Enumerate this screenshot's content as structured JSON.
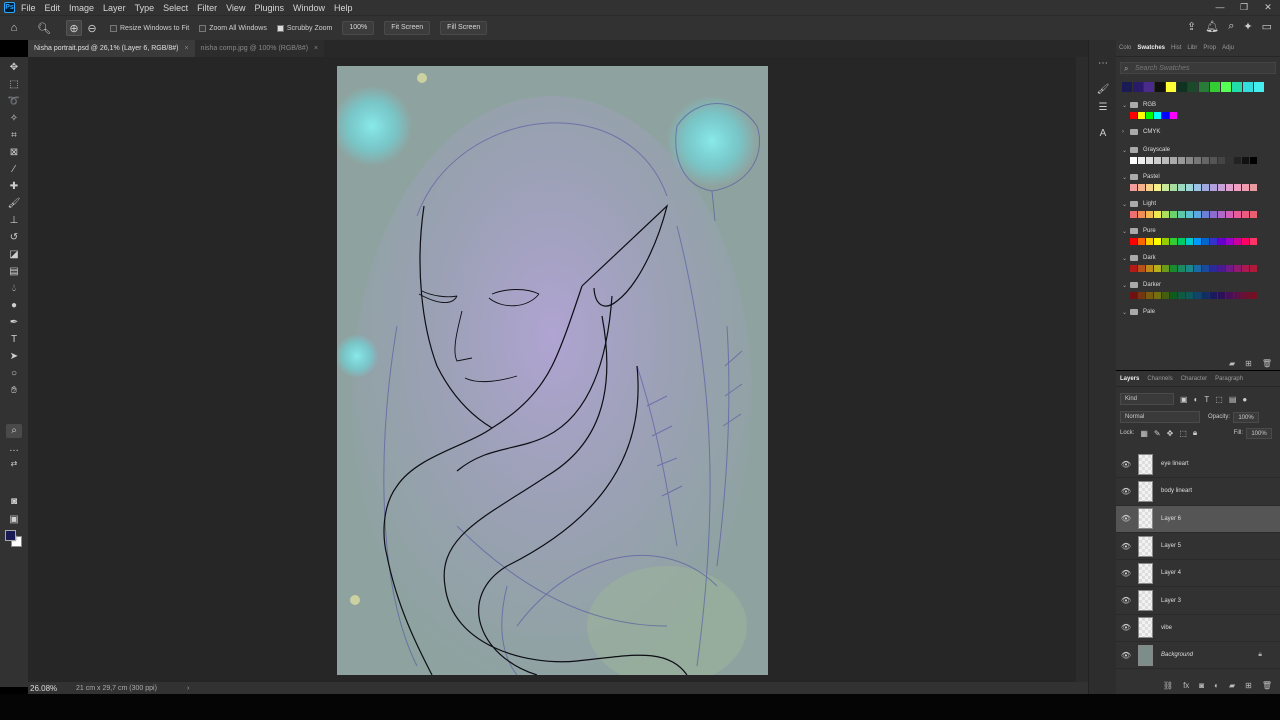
{
  "app": {
    "logo_text": "Ps"
  },
  "menu": [
    "File",
    "Edit",
    "Image",
    "Layer",
    "Type",
    "Select",
    "Filter",
    "View",
    "Plugins",
    "Window",
    "Help"
  ],
  "window_controls": {
    "minimize": "—",
    "restore": "❐",
    "close": "✕"
  },
  "options": {
    "resize_windows": "Resize Windows to Fit",
    "zoom_all": "Zoom All Windows",
    "scrubby_zoom": "Scrubby Zoom",
    "scrubby_checked": true,
    "btn_100": "100%",
    "btn_fit": "Fit Screen",
    "btn_fill": "Fill Screen"
  },
  "tabs": [
    {
      "label": "Nisha portrait.psd @ 26,1% (Layer 6, RGB/8#)",
      "active": true
    },
    {
      "label": "nisha comp.jpg @ 100% (RGB/8#)",
      "active": false
    }
  ],
  "status": {
    "zoom": "26.08%",
    "dims": "21 cm x 29,7 cm (300 ppi)",
    "arrow": "›"
  },
  "swatches": {
    "tabs": [
      "Colo",
      "Swatches",
      "Hist",
      "Libr",
      "Prop",
      "Adju"
    ],
    "search_placeholder": "Search Swatches",
    "recent": [
      "#1a1a55",
      "#2a1a6a",
      "#4a2a8a",
      "#111111",
      "#ffff33",
      "#0f3320",
      "#1a4a2a",
      "#2a7a3a",
      "#33cc33",
      "#55ff55",
      "#22ddaa",
      "#33dddd",
      "#44eeee"
    ],
    "groups": [
      {
        "name": "RGB",
        "expanded": true,
        "colors": [
          "#ff0000",
          "#ffff00",
          "#00ff00",
          "#00ffff",
          "#0000ff",
          "#ff00ff"
        ]
      },
      {
        "name": "CMYK",
        "expanded": false,
        "colors": []
      },
      {
        "name": "Grayscale",
        "expanded": true,
        "colors": [
          "#ffffff",
          "#eeeeee",
          "#dddddd",
          "#cccccc",
          "#bbbbbb",
          "#aaaaaa",
          "#999999",
          "#888888",
          "#777777",
          "#666666",
          "#555555",
          "#444444",
          "#333333",
          "#222222",
          "#111111",
          "#000000"
        ]
      },
      {
        "name": "Pastel",
        "expanded": true,
        "colors": [
          "#f29c9c",
          "#f5b08c",
          "#f7d08a",
          "#f5f08a",
          "#c8e89a",
          "#a8dca0",
          "#9cd8c0",
          "#9cd6d8",
          "#9cc4e8",
          "#a0a8e0",
          "#b0a0dc",
          "#c8a0d8",
          "#e0a0d0",
          "#f0a0c0",
          "#f09cb0",
          "#e89aa0"
        ]
      },
      {
        "name": "Light",
        "expanded": true,
        "colors": [
          "#ee6f6f",
          "#f08f55",
          "#f4b850",
          "#f0e850",
          "#aedc5c",
          "#6cd06c",
          "#5cc8a8",
          "#5cc0d0",
          "#5ca8e0",
          "#6c80d8",
          "#8c6cd0",
          "#b068c8",
          "#d060b8",
          "#e85c98",
          "#ec5c80",
          "#e86070"
        ]
      },
      {
        "name": "Pure",
        "expanded": true,
        "colors": [
          "#ff0000",
          "#ff6600",
          "#ffcc00",
          "#ffff00",
          "#99cc00",
          "#33cc33",
          "#00cc66",
          "#00cccc",
          "#0099ff",
          "#0066cc",
          "#3333cc",
          "#6600cc",
          "#9900cc",
          "#cc0099",
          "#ff0066",
          "#ff3366"
        ]
      },
      {
        "name": "Dark",
        "expanded": true,
        "colors": [
          "#b31a1a",
          "#b8501a",
          "#c08a1a",
          "#b8b01a",
          "#6c9a1a",
          "#1a8a30",
          "#1a8a60",
          "#1a8888",
          "#1a6aa8",
          "#1a4a9a",
          "#2a2a98",
          "#4a1a90",
          "#701a88",
          "#901a70",
          "#a81a50",
          "#b01a38"
        ]
      },
      {
        "name": "Darker",
        "expanded": true,
        "colors": [
          "#701010",
          "#743810",
          "#785a10",
          "#747010",
          "#445e10",
          "#105a20",
          "#105a40",
          "#105858",
          "#104468",
          "#102e62",
          "#1a1a5e",
          "#2e105a",
          "#461056",
          "#5a1046",
          "#6a1032",
          "#701022"
        ]
      },
      {
        "name": "Pale",
        "expanded": true,
        "colors": []
      }
    ]
  },
  "layers_panel": {
    "tabs": [
      "Layers",
      "Channels",
      "Character",
      "Paragraph"
    ],
    "kind": "Kind",
    "blend": "Normal",
    "opacity_label": "Opacity:",
    "opacity": "100%",
    "lock_label": "Lock:",
    "fill_label": "Fill:",
    "fill": "100%",
    "layers": [
      {
        "name": "eye lineart",
        "selected": false
      },
      {
        "name": "body lineart",
        "selected": false
      },
      {
        "name": "Layer 6",
        "selected": true
      },
      {
        "name": "Layer 5",
        "selected": false
      },
      {
        "name": "Layer 4",
        "selected": false
      },
      {
        "name": "Layer 3",
        "selected": false
      },
      {
        "name": "vibe",
        "selected": false
      },
      {
        "name": "Background",
        "selected": false,
        "locked": true
      }
    ]
  },
  "canvas_colors": {
    "paper": "#8a9f9c",
    "glow": "#7fe0e0",
    "hair": "#a29ac4",
    "line": "#0d0d14"
  }
}
